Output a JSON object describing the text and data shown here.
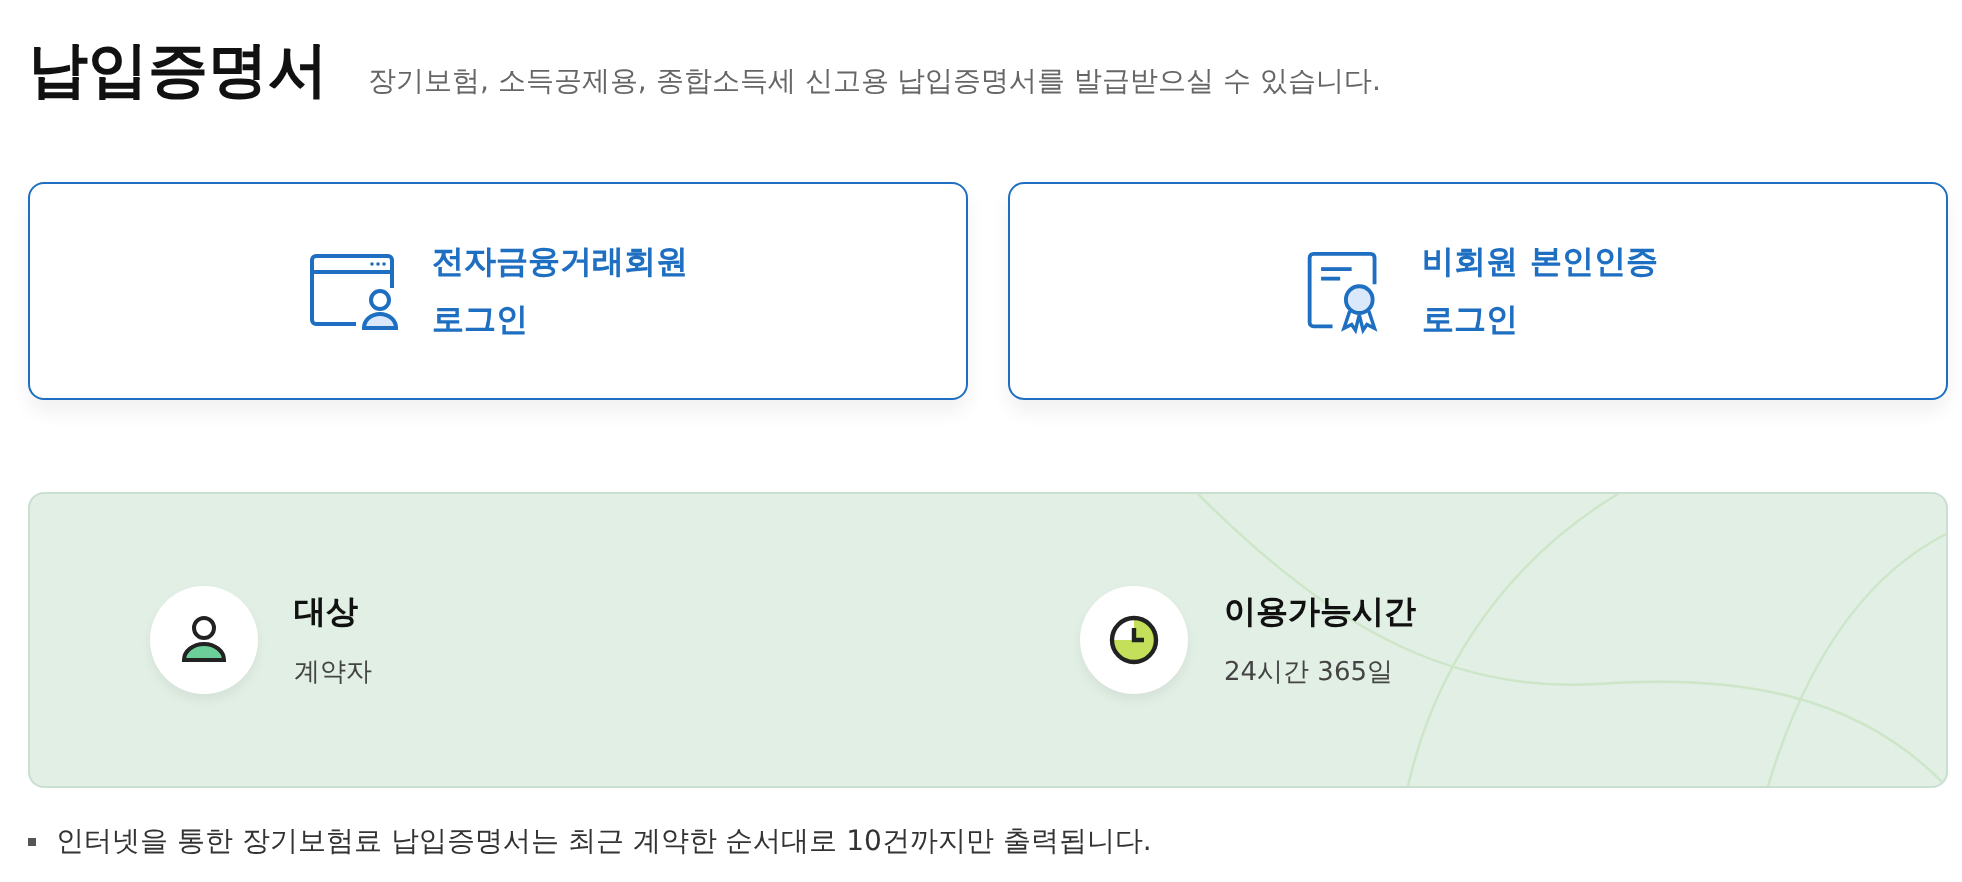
{
  "header": {
    "title": "납입증명서",
    "subtitle": "장기보험, 소득공제용, 종합소득세 신고용 납입증명서를 발급받으실 수 있습니다."
  },
  "login_options": [
    {
      "kind": "member",
      "line_1": "전자금융거래회원",
      "line_2": "로그인"
    },
    {
      "kind": "certificate",
      "line_1": "비회원 본인인증",
      "line_2": "로그인"
    }
  ],
  "info": [
    {
      "kind": "person",
      "label": "대상",
      "value": "계약자"
    },
    {
      "kind": "clock",
      "label": "이용가능시간",
      "value": "24시간 365일"
    }
  ],
  "notes": [
    "인터넷을 통한 장기보험료 납입증명서는 최근 계약한 순서대로 10건까지만 출력됩니다."
  ]
}
